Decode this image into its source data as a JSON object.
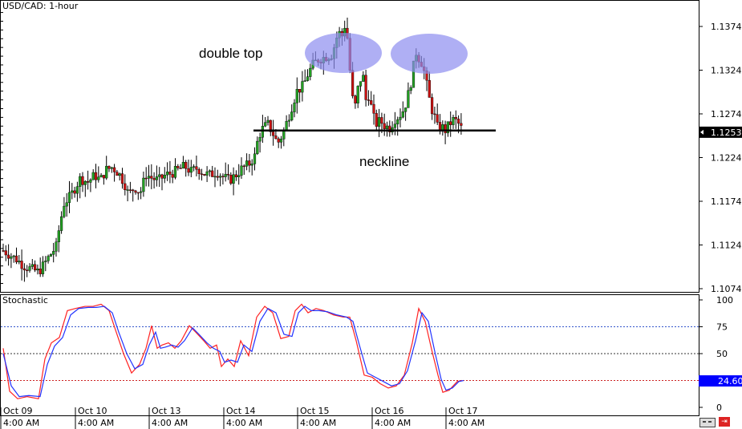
{
  "header": {
    "title": "USD/CAD: 1-hour"
  },
  "annotations": {
    "double_top": "double top",
    "neckline": "neckline"
  },
  "colors": {
    "bull": "#22a022",
    "bear": "#cc1111",
    "ellipse": "#8d8df0",
    "stoch_k": "#ff2222",
    "stoch_d": "#2233ff",
    "tag_bg": "#0000ff"
  },
  "chart_data": [
    {
      "type": "candlestick",
      "title": "USD/CAD: 1-hour",
      "ylim": [
        1.1056,
        1.1406
      ],
      "y_ticks": [
        "1.1374",
        "1.1324",
        "1.1274",
        "1.1224",
        "1.1174",
        "1.1124",
        "1.1074"
      ],
      "current_price": "1.1253",
      "x_ticks": [
        {
          "top": "Oct 09",
          "bottom": "4:00 AM"
        },
        {
          "top": "Oct 10",
          "bottom": "4:00 AM"
        },
        {
          "top": "Oct 13",
          "bottom": "4:00 AM"
        },
        {
          "top": "Oct 14",
          "bottom": "4:00 AM"
        },
        {
          "top": "Oct 15",
          "bottom": "4:00 AM"
        },
        {
          "top": "Oct 16",
          "bottom": "4:00 AM"
        },
        {
          "top": "Oct 17",
          "bottom": "4:00 AM"
        }
      ],
      "neckline": 1.1255,
      "close_path": [
        [
          0,
          1.112
        ],
        [
          10,
          1.1114
        ],
        [
          20,
          1.1108
        ],
        [
          30,
          1.11
        ],
        [
          40,
          1.1096
        ],
        [
          48,
          1.1093
        ],
        [
          55,
          1.1102
        ],
        [
          62,
          1.1112
        ],
        [
          70,
          1.1122
        ],
        [
          75,
          1.115
        ],
        [
          80,
          1.1172
        ],
        [
          88,
          1.118
        ],
        [
          95,
          1.1192
        ],
        [
          100,
          1.12
        ],
        [
          110,
          1.1196
        ],
        [
          118,
          1.1204
        ],
        [
          125,
          1.1198
        ],
        [
          132,
          1.121
        ],
        [
          140,
          1.1213
        ],
        [
          148,
          1.1206
        ],
        [
          155,
          1.1195
        ],
        [
          160,
          1.1182
        ],
        [
          168,
          1.119
        ],
        [
          175,
          1.1184
        ],
        [
          182,
          1.1205
        ],
        [
          190,
          1.12
        ],
        [
          198,
          1.1198
        ],
        [
          206,
          1.1204
        ],
        [
          214,
          1.1206
        ],
        [
          222,
          1.121
        ],
        [
          230,
          1.1214
        ],
        [
          238,
          1.1208
        ],
        [
          246,
          1.1212
        ],
        [
          254,
          1.1206
        ],
        [
          262,
          1.1204
        ],
        [
          270,
          1.1208
        ],
        [
          278,
          1.1202
        ],
        [
          286,
          1.1198
        ],
        [
          294,
          1.1204
        ],
        [
          302,
          1.1212
        ],
        [
          310,
          1.1216
        ],
        [
          318,
          1.1226
        ],
        [
          322,
          1.1248
        ],
        [
          328,
          1.1258
        ],
        [
          334,
          1.1262
        ],
        [
          340,
          1.1252
        ],
        [
          346,
          1.124
        ],
        [
          352,
          1.125
        ],
        [
          358,
          1.1266
        ],
        [
          364,
          1.1283
        ],
        [
          370,
          1.13
        ],
        [
          378,
          1.1306
        ],
        [
          384,
          1.132
        ],
        [
          390,
          1.133
        ],
        [
          396,
          1.1336
        ],
        [
          402,
          1.1338
        ],
        [
          408,
          1.134
        ],
        [
          414,
          1.1342
        ],
        [
          418,
          1.1356
        ],
        [
          422,
          1.1368
        ],
        [
          426,
          1.1362
        ],
        [
          430,
          1.1376
        ],
        [
          434,
          1.1356
        ],
        [
          438,
          1.13
        ],
        [
          442,
          1.1278
        ],
        [
          446,
          1.1302
        ],
        [
          452,
          1.1322
        ],
        [
          456,
          1.129
        ],
        [
          460,
          1.1296
        ],
        [
          464,
          1.1276
        ],
        [
          468,
          1.1262
        ],
        [
          474,
          1.1266
        ],
        [
          480,
          1.126
        ],
        [
          486,
          1.1258
        ],
        [
          492,
          1.1268
        ],
        [
          498,
          1.1272
        ],
        [
          504,
          1.128
        ],
        [
          510,
          1.13
        ],
        [
          514,
          1.1318
        ],
        [
          518,
          1.1346
        ],
        [
          522,
          1.1338
        ],
        [
          526,
          1.1332
        ],
        [
          530,
          1.1318
        ],
        [
          534,
          1.1296
        ],
        [
          538,
          1.128
        ],
        [
          542,
          1.127
        ],
        [
          546,
          1.1256
        ],
        [
          550,
          1.126
        ],
        [
          555,
          1.1255
        ],
        [
          560,
          1.1262
        ],
        [
          566,
          1.1268
        ],
        [
          572,
          1.1262
        ],
        [
          576,
          1.1256
        ]
      ]
    },
    {
      "type": "line",
      "title": "Stochastic",
      "ylim": [
        0,
        100
      ],
      "y_ticks": [
        "100",
        "75",
        "50",
        "0"
      ],
      "levels": [
        75,
        50,
        25
      ],
      "current_value": "24.60",
      "series": [
        {
          "color": "red",
          "points": [
            [
              0,
              55
            ],
            [
              8,
              15
            ],
            [
              18,
              8
            ],
            [
              30,
              10
            ],
            [
              44,
              8
            ],
            [
              52,
              45
            ],
            [
              60,
              60
            ],
            [
              70,
              65
            ],
            [
              80,
              90
            ],
            [
              90,
              92
            ],
            [
              102,
              94
            ],
            [
              112,
              94
            ],
            [
              122,
              96
            ],
            [
              132,
              90
            ],
            [
              140,
              72
            ],
            [
              150,
              50
            ],
            [
              160,
              32
            ],
            [
              170,
              40
            ],
            [
              178,
              55
            ],
            [
              185,
              76
            ],
            [
              192,
              55
            ],
            [
              198,
              58
            ],
            [
              206,
              60
            ],
            [
              214,
              55
            ],
            [
              222,
              62
            ],
            [
              232,
              76
            ],
            [
              240,
              70
            ],
            [
              250,
              62
            ],
            [
              258,
              55
            ],
            [
              266,
              58
            ],
            [
              272,
              38
            ],
            [
              280,
              45
            ],
            [
              288,
              38
            ],
            [
              296,
              62
            ],
            [
              306,
              48
            ],
            [
              316,
              84
            ],
            [
              326,
              94
            ],
            [
              336,
              88
            ],
            [
              346,
              64
            ],
            [
              356,
              66
            ],
            [
              364,
              90
            ],
            [
              372,
              96
            ],
            [
              380,
              88
            ],
            [
              390,
              92
            ],
            [
              400,
              90
            ],
            [
              412,
              86
            ],
            [
              424,
              84
            ],
            [
              432,
              84
            ],
            [
              440,
              62
            ],
            [
              450,
              30
            ],
            [
              460,
              28
            ],
            [
              470,
              22
            ],
            [
              480,
              18
            ],
            [
              490,
              20
            ],
            [
              500,
              30
            ],
            [
              510,
              60
            ],
            [
              518,
              92
            ],
            [
              526,
              80
            ],
            [
              534,
              54
            ],
            [
              542,
              30
            ],
            [
              548,
              14
            ],
            [
              556,
              16
            ],
            [
              566,
              24
            ],
            [
              572,
              25
            ]
          ]
        },
        {
          "color": "blue",
          "points": [
            [
              0,
              50
            ],
            [
              10,
              20
            ],
            [
              20,
              10
            ],
            [
              32,
              11
            ],
            [
              46,
              10
            ],
            [
              55,
              40
            ],
            [
              64,
              57
            ],
            [
              74,
              65
            ],
            [
              84,
              86
            ],
            [
              94,
              92
            ],
            [
              106,
              93
            ],
            [
              116,
              93
            ],
            [
              126,
              94
            ],
            [
              136,
              88
            ],
            [
              144,
              70
            ],
            [
              154,
              50
            ],
            [
              164,
              36
            ],
            [
              174,
              40
            ],
            [
              182,
              58
            ],
            [
              190,
              70
            ],
            [
              196,
              55
            ],
            [
              202,
              56
            ],
            [
              210,
              58
            ],
            [
              218,
              56
            ],
            [
              226,
              62
            ],
            [
              236,
              74
            ],
            [
              244,
              68
            ],
            [
              254,
              60
            ],
            [
              262,
              55
            ],
            [
              270,
              52
            ],
            [
              276,
              42
            ],
            [
              284,
              44
            ],
            [
              292,
              42
            ],
            [
              300,
              58
            ],
            [
              310,
              52
            ],
            [
              320,
              80
            ],
            [
              330,
              92
            ],
            [
              340,
              88
            ],
            [
              350,
              68
            ],
            [
              360,
              66
            ],
            [
              368,
              88
            ],
            [
              376,
              94
            ],
            [
              384,
              90
            ],
            [
              394,
              90
            ],
            [
              404,
              89
            ],
            [
              416,
              86
            ],
            [
              428,
              84
            ],
            [
              436,
              80
            ],
            [
              444,
              58
            ],
            [
              454,
              32
            ],
            [
              464,
              28
            ],
            [
              474,
              24
            ],
            [
              484,
              20
            ],
            [
              494,
              22
            ],
            [
              504,
              34
            ],
            [
              514,
              62
            ],
            [
              522,
              88
            ],
            [
              530,
              80
            ],
            [
              538,
              52
            ],
            [
              546,
              26
            ],
            [
              552,
              16
            ],
            [
              560,
              18
            ],
            [
              568,
              24
            ],
            [
              574,
              25
            ]
          ]
        }
      ]
    }
  ]
}
